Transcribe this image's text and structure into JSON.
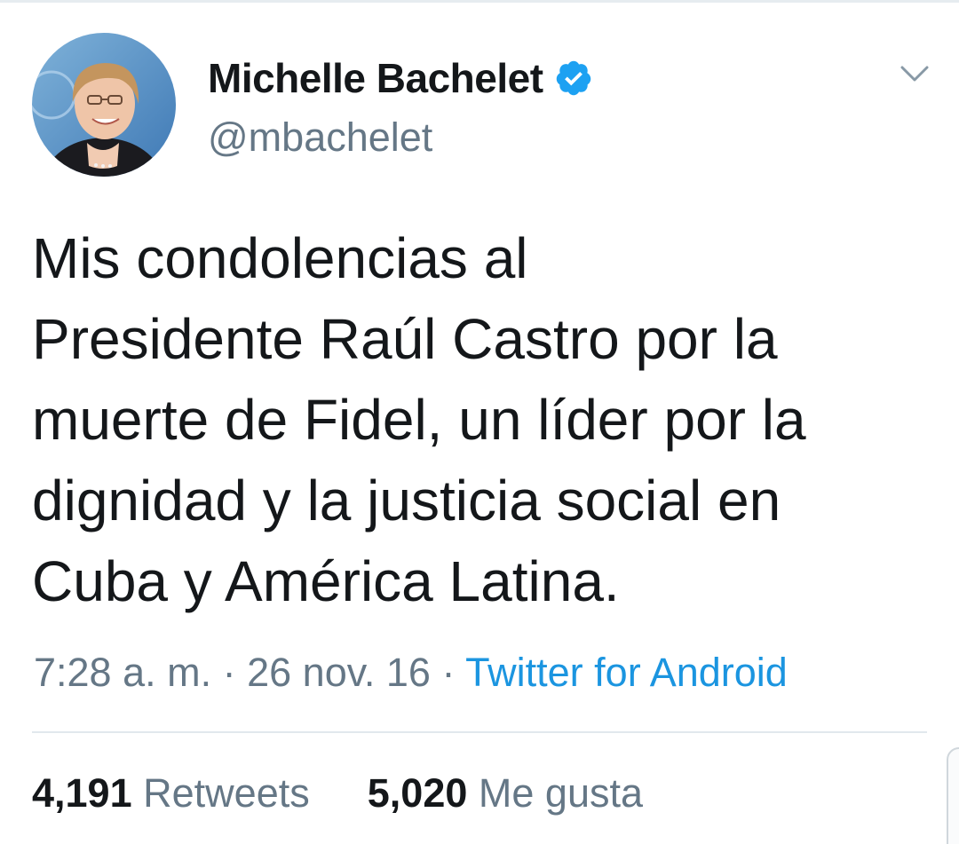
{
  "user": {
    "display_name": "Michelle Bachelet",
    "handle": "@mbachelet",
    "verified": true,
    "avatar_icon": "profile-photo"
  },
  "tweet": {
    "text": "Mis condolencias al\nPresidente Raúl Castro por la\nmuerte de Fidel, un líder por la\ndignidad y la justicia social en\nCuba y América Latina."
  },
  "meta": {
    "time": "7:28 a. m.",
    "separator": " · ",
    "date": "26 nov. 16",
    "source": "Twitter for Android"
  },
  "stats": {
    "retweets_count": "4,191",
    "retweets_label": "Retweets",
    "likes_count": "5,020",
    "likes_label": "Me gusta"
  },
  "colors": {
    "text": "#14171a",
    "secondary": "#657786",
    "link": "#1b95e0",
    "verified": "#1da1f2",
    "divider": "#e1e8ed"
  },
  "icons": {
    "verified": "verified-badge-icon",
    "menu": "chevron-down-icon"
  }
}
